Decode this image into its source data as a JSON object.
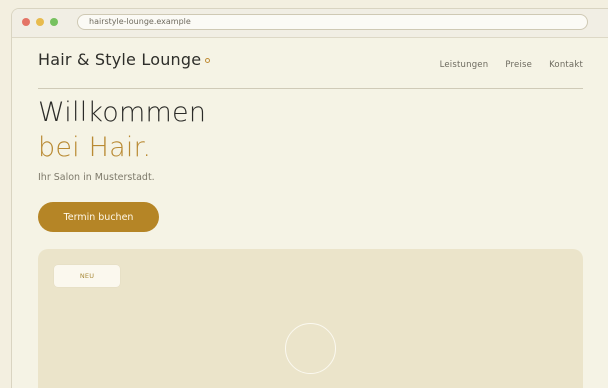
{
  "browser": {
    "url": "hairstyle-lounge.example"
  },
  "header": {
    "brand": "Hair & Style Lounge",
    "nav": [
      "Leistungen",
      "Preise",
      "Kontakt"
    ]
  },
  "hero": {
    "title_line1": "Willkommen",
    "title_line2": "bei Hair.",
    "subtitle": "Ihr Salon in Musterstadt.",
    "cta_label": "Termin buchen"
  },
  "media": {
    "badge": "NEU",
    "icon": "play-circle-icon"
  },
  "colors": {
    "accent": "#b58526",
    "background": "#f5f3e5",
    "card": "#ebe4ca"
  }
}
